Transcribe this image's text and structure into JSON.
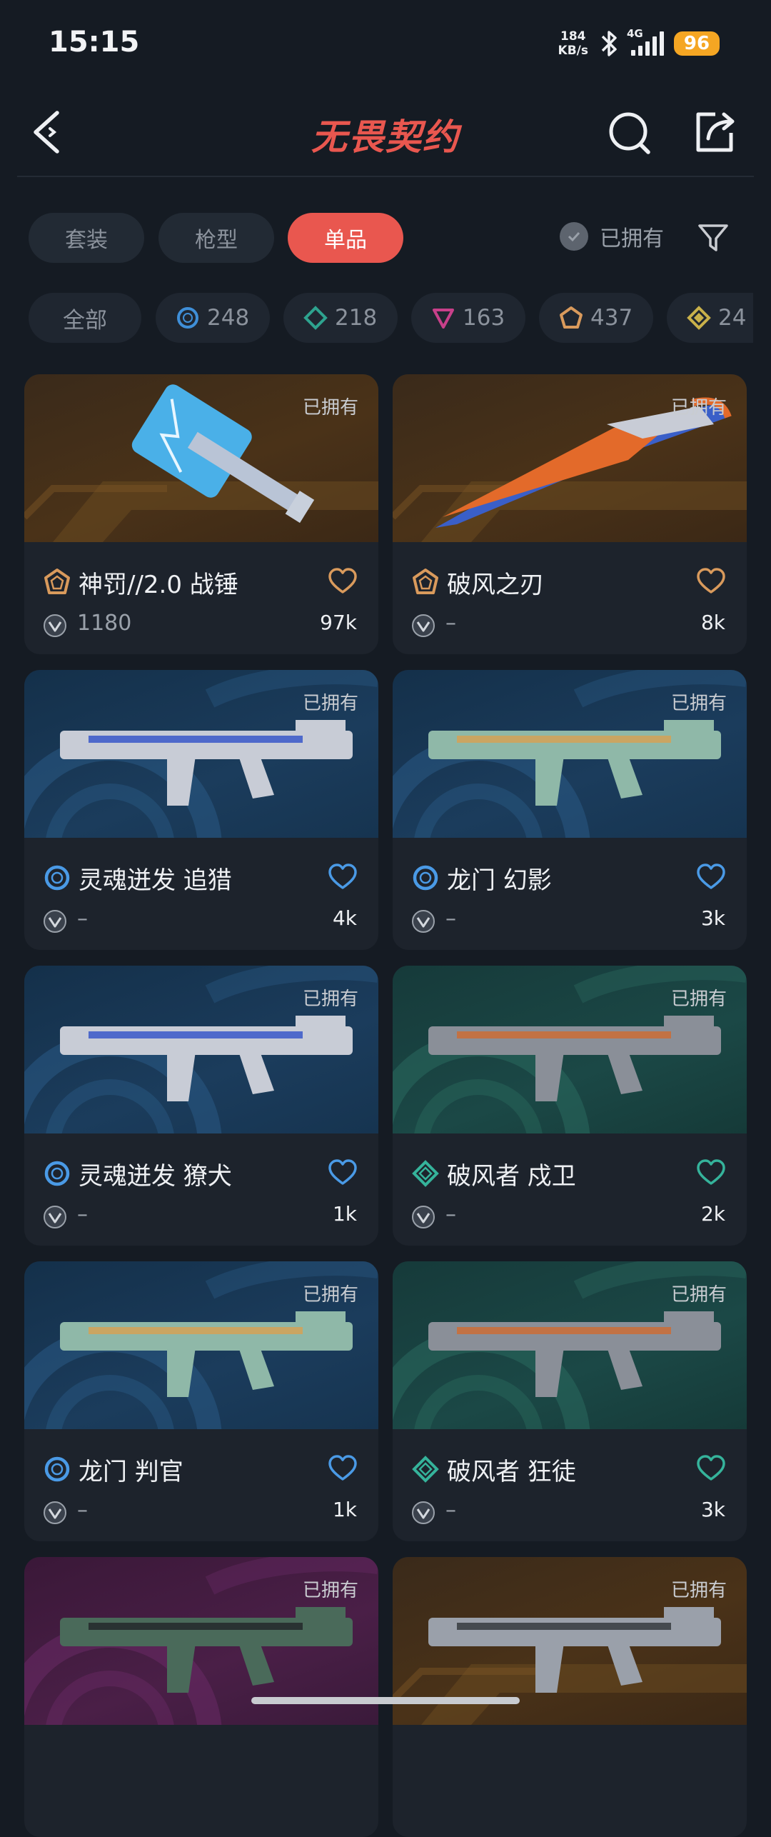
{
  "status_bar": {
    "time": "15:15",
    "net_speed": "184",
    "net_unit": "KB/s",
    "network": "4G",
    "battery": "96"
  },
  "header": {
    "title": "无畏契约"
  },
  "tabs": [
    {
      "label": "套装",
      "active": false
    },
    {
      "label": "枪型",
      "active": false
    },
    {
      "label": "单品",
      "active": true
    }
  ],
  "owned_filter_label": "已拥有",
  "chips": [
    {
      "label": "全部",
      "tier": ""
    },
    {
      "label": "248",
      "tier": "select",
      "color": "#3f8fd8"
    },
    {
      "label": "218",
      "tier": "deluxe",
      "color": "#2ea38f"
    },
    {
      "label": "163",
      "tier": "premium",
      "color": "#c8408a"
    },
    {
      "label": "437",
      "tier": "exclusive",
      "color": "#d99a5c"
    },
    {
      "label": "24",
      "tier": "ultra",
      "color": "#c9b14a"
    }
  ],
  "cards": [
    {
      "owned": "已拥有",
      "name": "神罚//2.0 战锤",
      "price": "1180",
      "likes": "97k",
      "tier": "exclusive",
      "tier_color": "#d99a5c",
      "bg": "orange"
    },
    {
      "owned": "已拥有",
      "name": "破风之刃",
      "price": "–",
      "likes": "8k",
      "tier": "exclusive",
      "tier_color": "#d99a5c",
      "bg": "orange"
    },
    {
      "owned": "已拥有",
      "name": "灵魂迸发 追猎",
      "price": "–",
      "likes": "4k",
      "tier": "select",
      "tier_color": "#4a9ae6",
      "bg": "blue"
    },
    {
      "owned": "已拥有",
      "name": "龙门 幻影",
      "price": "–",
      "likes": "3k",
      "tier": "select",
      "tier_color": "#4a9ae6",
      "bg": "blue"
    },
    {
      "owned": "已拥有",
      "name": "灵魂迸发 獠犬",
      "price": "–",
      "likes": "1k",
      "tier": "select",
      "tier_color": "#4a9ae6",
      "bg": "blue"
    },
    {
      "owned": "已拥有",
      "name": "破风者 戍卫",
      "price": "–",
      "likes": "2k",
      "tier": "deluxe",
      "tier_color": "#35b39b",
      "bg": "green"
    },
    {
      "owned": "已拥有",
      "name": "龙门 判官",
      "price": "–",
      "likes": "1k",
      "tier": "select",
      "tier_color": "#4a9ae6",
      "bg": "blue"
    },
    {
      "owned": "已拥有",
      "name": "破风者 狂徒",
      "price": "–",
      "likes": "3k",
      "tier": "deluxe",
      "tier_color": "#35b39b",
      "bg": "green"
    },
    {
      "owned": "已拥有",
      "bg": "purple"
    },
    {
      "owned": "已拥有",
      "bg": "orange"
    }
  ]
}
